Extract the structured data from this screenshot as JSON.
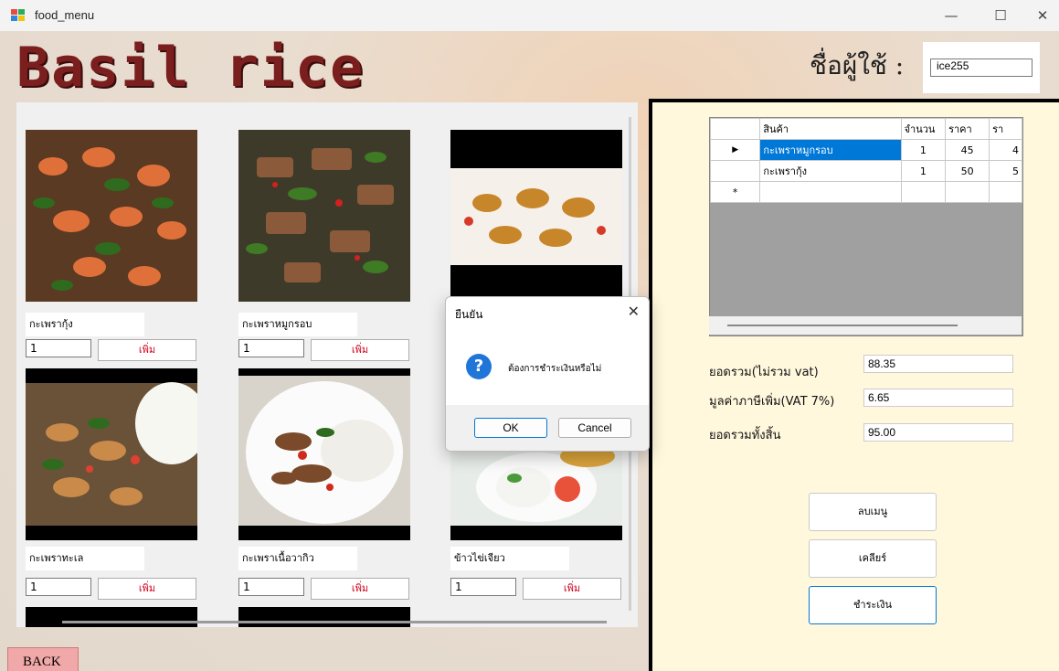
{
  "window": {
    "title": "food_menu",
    "minimize": "—",
    "maximize": "☐",
    "close": "✕"
  },
  "header": {
    "brand": "Basil rice",
    "user_label": "ชื่อผู้ใช้ :",
    "username": "ice255"
  },
  "menu": {
    "items": [
      {
        "name": "กะเพรากุ้ง",
        "qty": "1",
        "add_label": "เพิ่ม"
      },
      {
        "name": "กะเพราหมูกรอบ",
        "qty": "1",
        "add_label": "เพิ่ม"
      },
      {
        "name": "กะเพราทะเล",
        "qty": "1",
        "add_label": "เพิ่ม"
      },
      {
        "name": "กะเพราเนื้อวากิว",
        "qty": "1",
        "add_label": "เพิ่ม"
      },
      {
        "name": "ข้าวไข่เจียว",
        "qty": "1",
        "add_label": "เพิ่ม"
      }
    ]
  },
  "order_grid": {
    "columns": [
      "สินค้า",
      "จำนวน",
      "ราคา",
      "รา"
    ],
    "rows": [
      {
        "item": "กะเพราหมูกรอบ",
        "qty": "1",
        "price": "45",
        "total": "4"
      },
      {
        "item": "กะเพรากุ้ง",
        "qty": "1",
        "price": "50",
        "total": "5"
      }
    ],
    "current_marker": "▶",
    "new_marker": "*"
  },
  "summary": {
    "subtotal_label": "ยอดรวม(ไม่รวม vat)",
    "subtotal": "88.35",
    "vat_label": "มูลค่าภาษีเพิ่ม(VAT 7%)",
    "vat": "6.65",
    "total_label": "ยอดรวมทั้งสิ้น",
    "total": "95.00"
  },
  "actions": {
    "delete": "ลบเมนู",
    "clear": "เคลียร์",
    "pay": "ชำระเงิน"
  },
  "back_label": "BACK",
  "dialog": {
    "title": "ยืนยัน",
    "icon": "?",
    "message": "ต้องการชำระเงินหรือไม่",
    "ok": "OK",
    "cancel": "Cancel",
    "close": "✕"
  },
  "colors": {
    "brand": "#7a1e1e",
    "add_text": "#d0021b",
    "selection": "#0078d7",
    "right_panel": "#fff8dd"
  }
}
